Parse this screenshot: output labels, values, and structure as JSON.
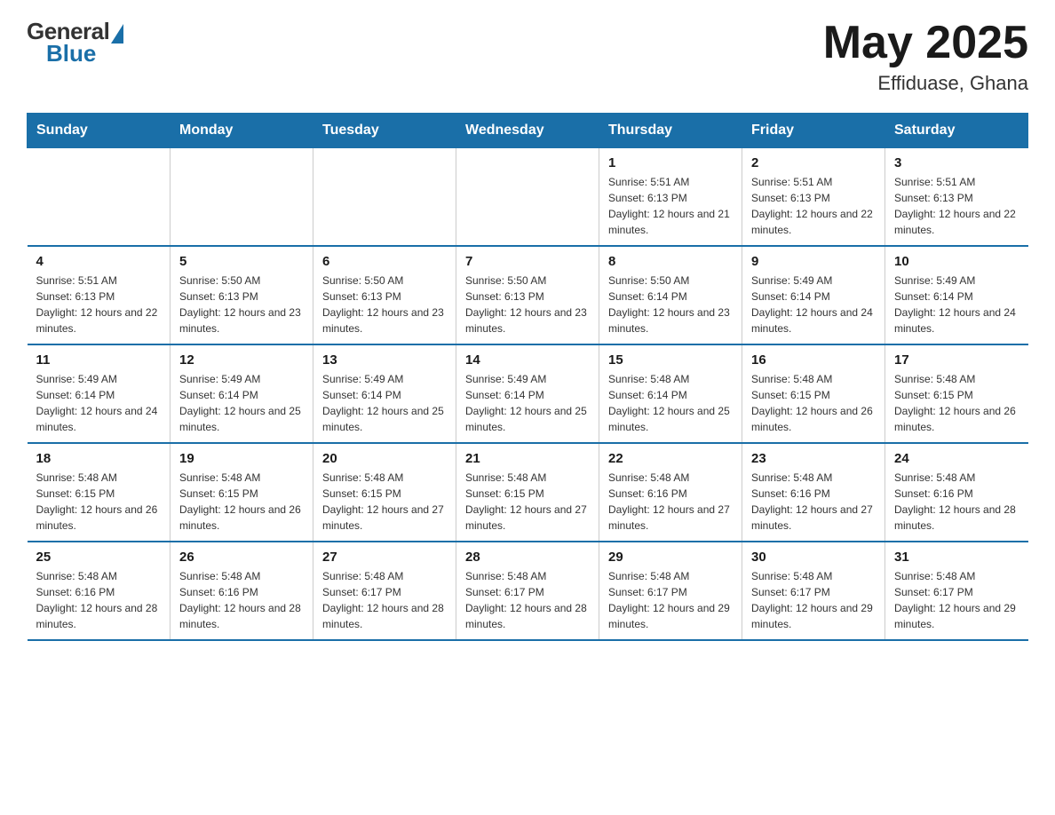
{
  "logo": {
    "general": "General",
    "blue": "Blue"
  },
  "header": {
    "month_year": "May 2025",
    "location": "Effiduase, Ghana"
  },
  "days_of_week": [
    "Sunday",
    "Monday",
    "Tuesday",
    "Wednesday",
    "Thursday",
    "Friday",
    "Saturday"
  ],
  "weeks": [
    [
      {
        "day": "",
        "info": ""
      },
      {
        "day": "",
        "info": ""
      },
      {
        "day": "",
        "info": ""
      },
      {
        "day": "",
        "info": ""
      },
      {
        "day": "1",
        "info": "Sunrise: 5:51 AM\nSunset: 6:13 PM\nDaylight: 12 hours and 21 minutes."
      },
      {
        "day": "2",
        "info": "Sunrise: 5:51 AM\nSunset: 6:13 PM\nDaylight: 12 hours and 22 minutes."
      },
      {
        "day": "3",
        "info": "Sunrise: 5:51 AM\nSunset: 6:13 PM\nDaylight: 12 hours and 22 minutes."
      }
    ],
    [
      {
        "day": "4",
        "info": "Sunrise: 5:51 AM\nSunset: 6:13 PM\nDaylight: 12 hours and 22 minutes."
      },
      {
        "day": "5",
        "info": "Sunrise: 5:50 AM\nSunset: 6:13 PM\nDaylight: 12 hours and 23 minutes."
      },
      {
        "day": "6",
        "info": "Sunrise: 5:50 AM\nSunset: 6:13 PM\nDaylight: 12 hours and 23 minutes."
      },
      {
        "day": "7",
        "info": "Sunrise: 5:50 AM\nSunset: 6:13 PM\nDaylight: 12 hours and 23 minutes."
      },
      {
        "day": "8",
        "info": "Sunrise: 5:50 AM\nSunset: 6:14 PM\nDaylight: 12 hours and 23 minutes."
      },
      {
        "day": "9",
        "info": "Sunrise: 5:49 AM\nSunset: 6:14 PM\nDaylight: 12 hours and 24 minutes."
      },
      {
        "day": "10",
        "info": "Sunrise: 5:49 AM\nSunset: 6:14 PM\nDaylight: 12 hours and 24 minutes."
      }
    ],
    [
      {
        "day": "11",
        "info": "Sunrise: 5:49 AM\nSunset: 6:14 PM\nDaylight: 12 hours and 24 minutes."
      },
      {
        "day": "12",
        "info": "Sunrise: 5:49 AM\nSunset: 6:14 PM\nDaylight: 12 hours and 25 minutes."
      },
      {
        "day": "13",
        "info": "Sunrise: 5:49 AM\nSunset: 6:14 PM\nDaylight: 12 hours and 25 minutes."
      },
      {
        "day": "14",
        "info": "Sunrise: 5:49 AM\nSunset: 6:14 PM\nDaylight: 12 hours and 25 minutes."
      },
      {
        "day": "15",
        "info": "Sunrise: 5:48 AM\nSunset: 6:14 PM\nDaylight: 12 hours and 25 minutes."
      },
      {
        "day": "16",
        "info": "Sunrise: 5:48 AM\nSunset: 6:15 PM\nDaylight: 12 hours and 26 minutes."
      },
      {
        "day": "17",
        "info": "Sunrise: 5:48 AM\nSunset: 6:15 PM\nDaylight: 12 hours and 26 minutes."
      }
    ],
    [
      {
        "day": "18",
        "info": "Sunrise: 5:48 AM\nSunset: 6:15 PM\nDaylight: 12 hours and 26 minutes."
      },
      {
        "day": "19",
        "info": "Sunrise: 5:48 AM\nSunset: 6:15 PM\nDaylight: 12 hours and 26 minutes."
      },
      {
        "day": "20",
        "info": "Sunrise: 5:48 AM\nSunset: 6:15 PM\nDaylight: 12 hours and 27 minutes."
      },
      {
        "day": "21",
        "info": "Sunrise: 5:48 AM\nSunset: 6:15 PM\nDaylight: 12 hours and 27 minutes."
      },
      {
        "day": "22",
        "info": "Sunrise: 5:48 AM\nSunset: 6:16 PM\nDaylight: 12 hours and 27 minutes."
      },
      {
        "day": "23",
        "info": "Sunrise: 5:48 AM\nSunset: 6:16 PM\nDaylight: 12 hours and 27 minutes."
      },
      {
        "day": "24",
        "info": "Sunrise: 5:48 AM\nSunset: 6:16 PM\nDaylight: 12 hours and 28 minutes."
      }
    ],
    [
      {
        "day": "25",
        "info": "Sunrise: 5:48 AM\nSunset: 6:16 PM\nDaylight: 12 hours and 28 minutes."
      },
      {
        "day": "26",
        "info": "Sunrise: 5:48 AM\nSunset: 6:16 PM\nDaylight: 12 hours and 28 minutes."
      },
      {
        "day": "27",
        "info": "Sunrise: 5:48 AM\nSunset: 6:17 PM\nDaylight: 12 hours and 28 minutes."
      },
      {
        "day": "28",
        "info": "Sunrise: 5:48 AM\nSunset: 6:17 PM\nDaylight: 12 hours and 28 minutes."
      },
      {
        "day": "29",
        "info": "Sunrise: 5:48 AM\nSunset: 6:17 PM\nDaylight: 12 hours and 29 minutes."
      },
      {
        "day": "30",
        "info": "Sunrise: 5:48 AM\nSunset: 6:17 PM\nDaylight: 12 hours and 29 minutes."
      },
      {
        "day": "31",
        "info": "Sunrise: 5:48 AM\nSunset: 6:17 PM\nDaylight: 12 hours and 29 minutes."
      }
    ]
  ]
}
